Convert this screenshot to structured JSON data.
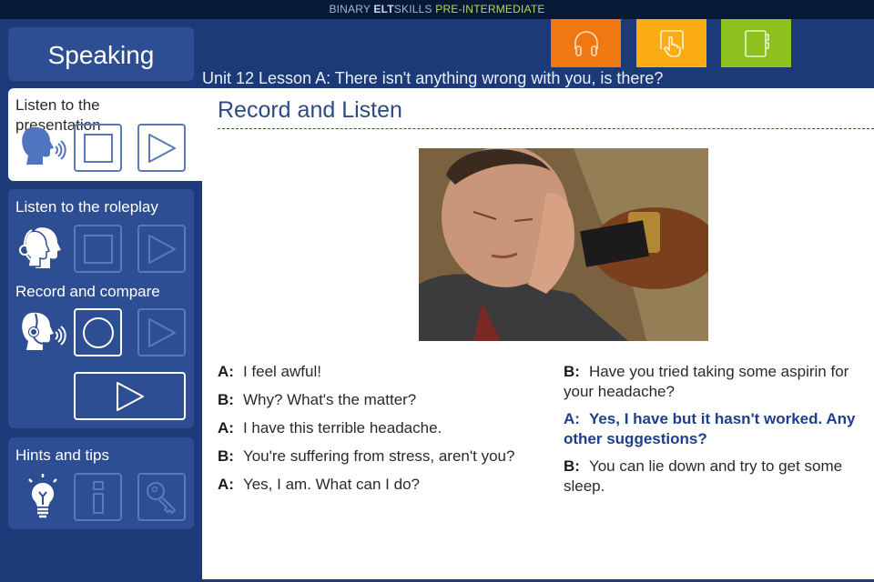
{
  "app": {
    "brand_prefix": "BINARY ",
    "brand_bold": "ELT",
    "brand_suffix": "SKILLS ",
    "level": "PRE-INTERMEDIATE"
  },
  "tiles": [
    {
      "icon": "headphones-icon",
      "color": "#f07812"
    },
    {
      "icon": "touch-hand-icon",
      "color": "#fbac12"
    },
    {
      "icon": "notebook-icon",
      "color": "#8cc11e"
    }
  ],
  "lesson_title": "Unit 12 Lesson A: There isn't anything wrong with you, is there?",
  "sidebar": {
    "section_title": "Speaking",
    "presentation": {
      "label": "Listen to the presentation"
    },
    "roleplay": {
      "label": "Listen to the roleplay"
    },
    "compare": {
      "label": "Record and compare"
    },
    "hints": {
      "label": "Hints and tips"
    }
  },
  "content": {
    "title": "Record and Listen",
    "photo_alt": "Man with a headache holding his head",
    "dialog_left": [
      {
        "speaker": "A:",
        "text": "I feel awful!"
      },
      {
        "speaker": "B:",
        "text": "Why? What's the matter?"
      },
      {
        "speaker": "A:",
        "text": "I have this terrible headache."
      },
      {
        "speaker": "B:",
        "text": "You're suffering from stress, aren't you?"
      },
      {
        "speaker": "A:",
        "text": "Yes, I am. What can I do?"
      }
    ],
    "dialog_right": [
      {
        "speaker": "B:",
        "text": "Have you tried taking some aspirin for your headache?"
      },
      {
        "speaker": "A:",
        "text": "Yes, I have but it hasn't worked. Any other suggestions?",
        "highlighted": true
      },
      {
        "speaker": "B:",
        "text": "You can lie down and try to get some sleep."
      }
    ]
  },
  "colors": {
    "background": "#1d3a78",
    "panel": "#2d4e92",
    "accent_text": "#1f3e8c"
  }
}
